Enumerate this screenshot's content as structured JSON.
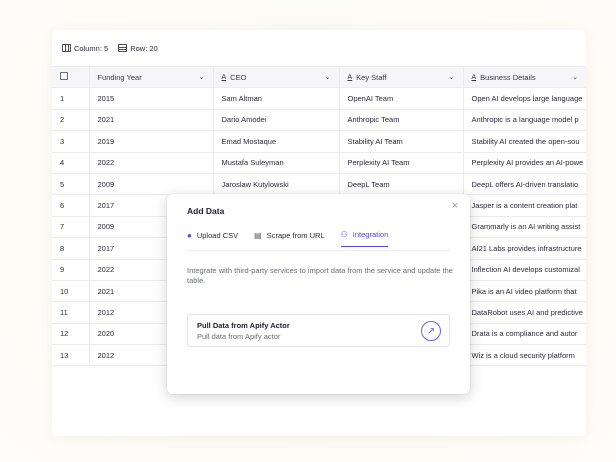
{
  "toolbar": {
    "columns_label": "Column: 5",
    "rows_label": "Row: 20"
  },
  "table": {
    "headers": [
      "Funding Year",
      "CEO",
      "Key Staff",
      "Business Details"
    ],
    "rows": [
      {
        "n": "1",
        "year": "2015",
        "ceo": "Sam Altman",
        "staff": "OpenAI Team",
        "details": "Open AI develops large language"
      },
      {
        "n": "2",
        "year": "2021",
        "ceo": "Dario Amodei",
        "staff": "Anthropic Team",
        "details": "Anthropic is a language model p"
      },
      {
        "n": "3",
        "year": "2019",
        "ceo": "Emad Mostaque",
        "staff": "Stability AI Team",
        "details": "Stability AI created the open-sou"
      },
      {
        "n": "4",
        "year": "2022",
        "ceo": "Mustafa Suleyman",
        "staff": "Perplexity AI Team",
        "details": "Perplexity AI provides an AI-powe"
      },
      {
        "n": "5",
        "year": "2009",
        "ceo": "Jaroslaw Kutylowski",
        "staff": "DeepL Team",
        "details": "DeepL offers AI-driven translatio"
      },
      {
        "n": "6",
        "year": "2017",
        "ceo": "",
        "staff": "",
        "details": "Jasper is a content creation plat"
      },
      {
        "n": "7",
        "year": "2009",
        "ceo": "",
        "staff": "",
        "details": "Grammarly is an AI writing assist"
      },
      {
        "n": "8",
        "year": "2017",
        "ceo": "",
        "staff": "",
        "details": "AI21 Labs provides infrastructure"
      },
      {
        "n": "9",
        "year": "2022",
        "ceo": "",
        "staff": "",
        "details": "Inflection AI develops customizal"
      },
      {
        "n": "10",
        "year": "2021",
        "ceo": "",
        "staff": "",
        "details": "Pika is an AI video platform that"
      },
      {
        "n": "11",
        "year": "2012",
        "ceo": "",
        "staff": "",
        "details": "DataRobot uses AI and predictive"
      },
      {
        "n": "12",
        "year": "2020",
        "ceo": "",
        "staff": "",
        "details": "Drata is a compliance and autor"
      },
      {
        "n": "13",
        "year": "2012",
        "ceo": "",
        "staff": "",
        "details": "Wiz is a cloud security platform"
      }
    ]
  },
  "modal": {
    "title": "Add Data",
    "tabs": [
      {
        "label": "Upload CSV"
      },
      {
        "label": "Scrape from URL"
      },
      {
        "label": "Integration"
      }
    ],
    "description": "Integrate with third-party services to import data from the service and update the table.",
    "actor_title": "Pull Data from Apify Actor",
    "actor_subtitle": "Pull data from Apify actor"
  }
}
